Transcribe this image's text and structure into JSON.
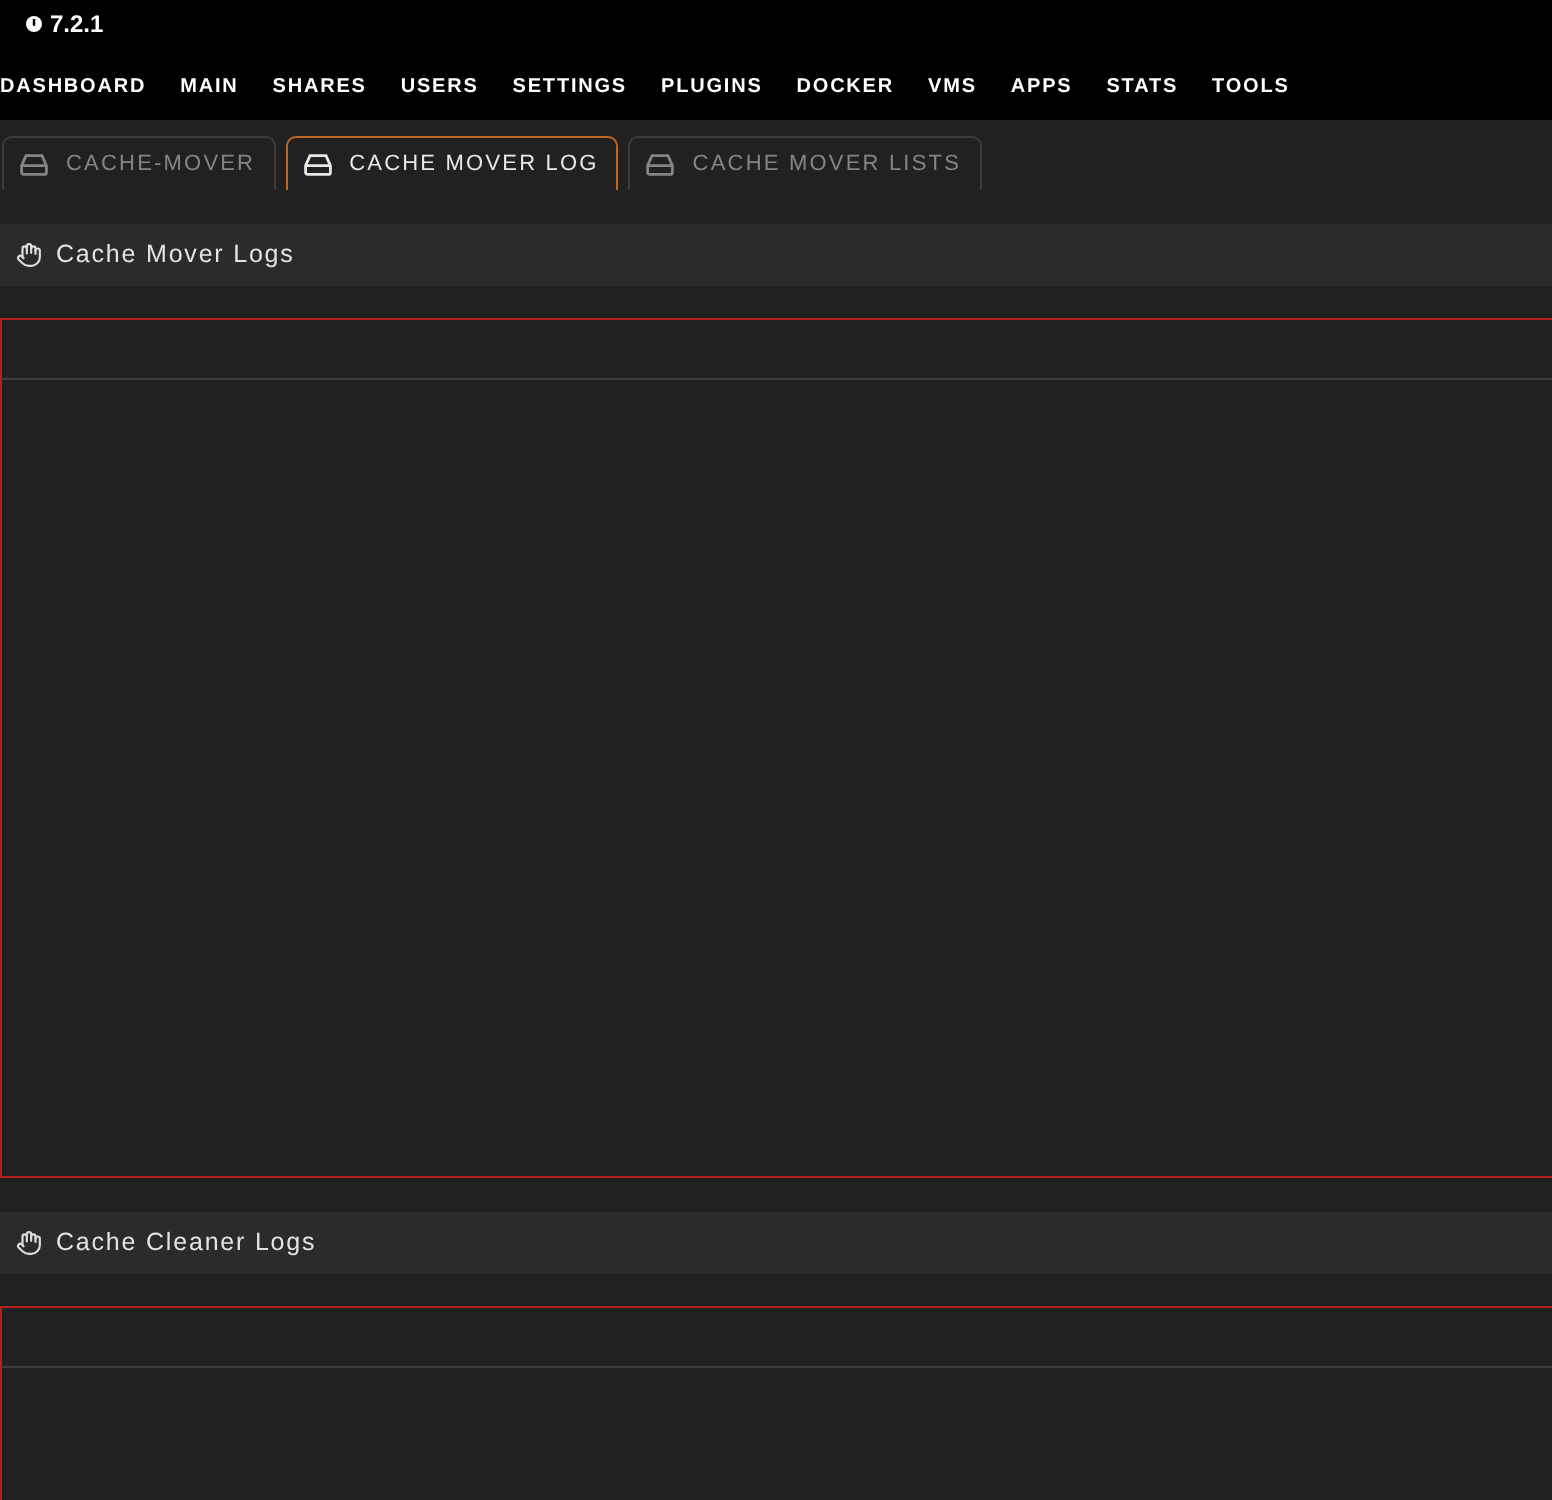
{
  "version": "7.2.1",
  "nav": [
    "DASHBOARD",
    "MAIN",
    "SHARES",
    "USERS",
    "SETTINGS",
    "PLUGINS",
    "DOCKER",
    "VMS",
    "APPS",
    "STATS",
    "TOOLS"
  ],
  "tabs": [
    {
      "label": "CACHE-MOVER",
      "selected": false
    },
    {
      "label": "CACHE MOVER LOG",
      "selected": true
    },
    {
      "label": "CACHE MOVER LISTS",
      "selected": false
    }
  ],
  "sections": [
    {
      "title": "Cache Mover Logs"
    },
    {
      "title": "Cache Cleaner Logs"
    }
  ]
}
